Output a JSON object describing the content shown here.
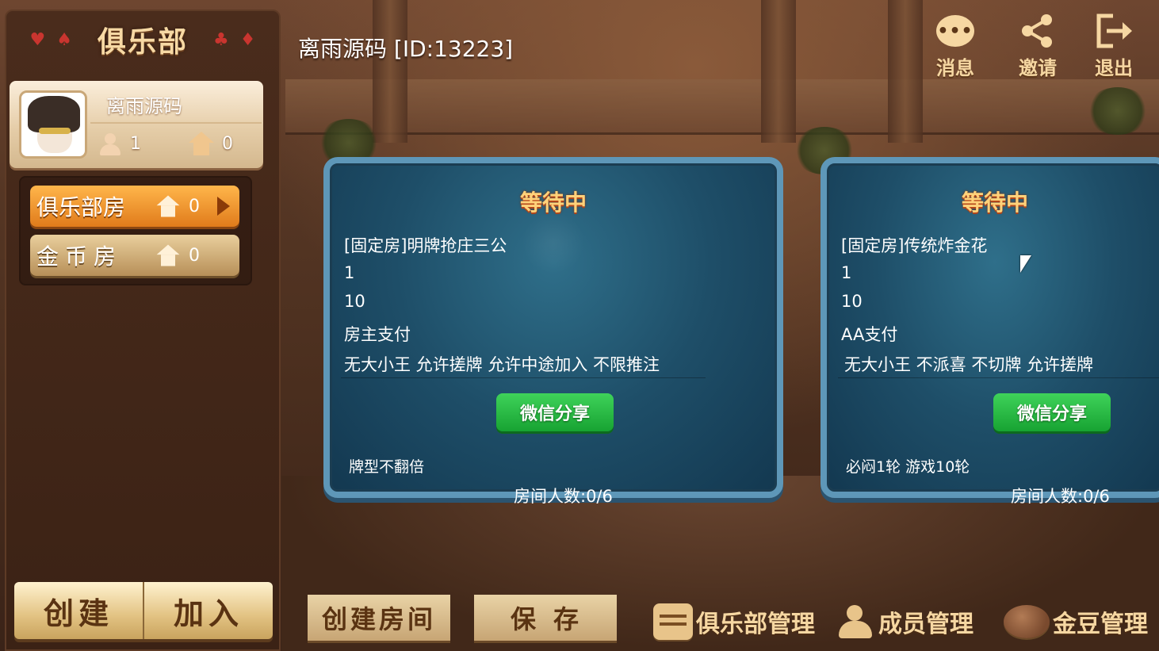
{
  "left_panel": {
    "header": {
      "title": "俱乐部"
    },
    "profile": {
      "name": "离雨源码",
      "members": "1",
      "rooms": "0"
    },
    "tabs": [
      {
        "label": "俱乐部房",
        "count": "0",
        "active": true
      },
      {
        "label": "金币房",
        "count": "0",
        "active": false
      }
    ],
    "buttons": {
      "create": "创建",
      "join": "加入"
    }
  },
  "header": {
    "club_title": "离雨源码 [ID:13223]",
    "actions": [
      {
        "label": "消息",
        "icon": "message-icon"
      },
      {
        "label": "邀请",
        "icon": "share-icon"
      },
      {
        "label": "退出",
        "icon": "exit-icon"
      }
    ]
  },
  "rooms": [
    {
      "status": "等待中",
      "name": "[固定房]明牌抢庄三公",
      "line2": "1",
      "line3": "10",
      "payment": "房主支付",
      "rules": "无大小王 允许搓牌 允许中途加入 不限推注",
      "share_label": "微信分享",
      "note": "牌型不翻倍",
      "players": "房间人数:0/6"
    },
    {
      "status": "等待中",
      "name": "[固定房]传统炸金花",
      "line2": "1",
      "line3": "10",
      "payment": "AA支付",
      "rules": "无大小王 不派喜 不切牌 允许搓牌",
      "share_label": "微信分享",
      "note": "必闷1轮 游戏10轮",
      "players": "房间人数:0/6"
    }
  ],
  "bottom_bar": {
    "create_room": "创建房间",
    "save": "保存",
    "club_manage": "俱乐部管理",
    "member_manage": "成员管理",
    "bean_manage": "金豆管理"
  },
  "colors": {
    "status_text": "#ffd27a",
    "share_button": "#17a332",
    "card_blue": "#1e4e68",
    "tab_active": "#e07b1b"
  }
}
